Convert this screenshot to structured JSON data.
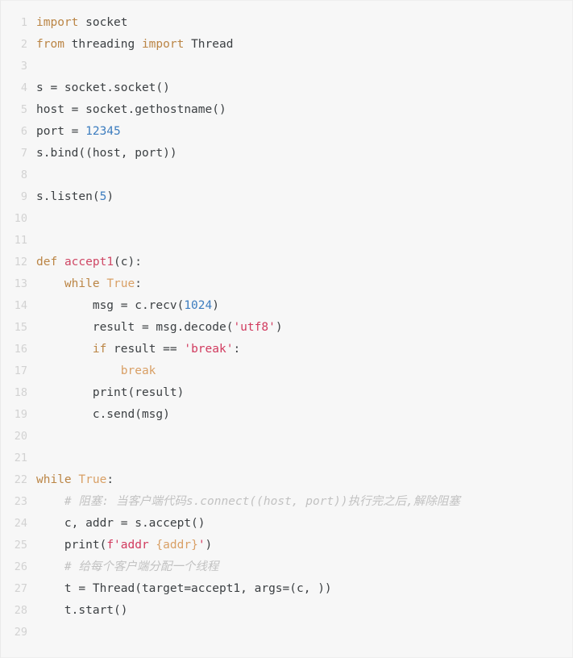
{
  "editor": {
    "language": "python",
    "background_color": "#f7f7f7",
    "border_color": "#eeeeee",
    "gutter_color": "#d2d2d2",
    "plain_text_color": "#3c4043",
    "keyword_color": "#bb8545",
    "builtin_color": "#d9a066",
    "number_color": "#3d7dbf",
    "string_color": "#d13a5e",
    "function_color": "#cf4765",
    "comment_color": "#c2c2c2",
    "total_lines": 29
  },
  "lines": [
    {
      "number": "1",
      "text": "import socket",
      "tokens": [
        {
          "t": "import",
          "c": "t-kw"
        },
        {
          "t": " socket",
          "c": "t-pl"
        }
      ]
    },
    {
      "number": "2",
      "text": "from threading import Thread",
      "tokens": [
        {
          "t": "from",
          "c": "t-kw"
        },
        {
          "t": " threading ",
          "c": "t-pl"
        },
        {
          "t": "import",
          "c": "t-kw"
        },
        {
          "t": " Thread",
          "c": "t-pl"
        }
      ]
    },
    {
      "number": "3",
      "text": "",
      "tokens": []
    },
    {
      "number": "4",
      "text": "s = socket.socket()",
      "tokens": [
        {
          "t": "s = socket.socket()",
          "c": "t-pl"
        }
      ]
    },
    {
      "number": "5",
      "text": "host = socket.gethostname()",
      "tokens": [
        {
          "t": "host = socket.gethostname()",
          "c": "t-pl"
        }
      ]
    },
    {
      "number": "6",
      "text": "port = 12345",
      "tokens": [
        {
          "t": "port = ",
          "c": "t-pl"
        },
        {
          "t": "12345",
          "c": "t-num"
        }
      ]
    },
    {
      "number": "7",
      "text": "s.bind((host, port))",
      "tokens": [
        {
          "t": "s.bind((host, port))",
          "c": "t-pl"
        }
      ]
    },
    {
      "number": "8",
      "text": "",
      "tokens": []
    },
    {
      "number": "9",
      "text": "s.listen(5)",
      "tokens": [
        {
          "t": "s.listen(",
          "c": "t-pl"
        },
        {
          "t": "5",
          "c": "t-num"
        },
        {
          "t": ")",
          "c": "t-pl"
        }
      ]
    },
    {
      "number": "10",
      "text": "",
      "tokens": []
    },
    {
      "number": "11",
      "text": "",
      "tokens": []
    },
    {
      "number": "12",
      "text": "def accept1(c):",
      "tokens": [
        {
          "t": "def",
          "c": "t-kw"
        },
        {
          "t": " ",
          "c": "t-pl"
        },
        {
          "t": "accept1",
          "c": "t-fn"
        },
        {
          "t": "(c):",
          "c": "t-pl"
        }
      ]
    },
    {
      "number": "13",
      "text": "    while True:",
      "tokens": [
        {
          "t": "    ",
          "c": "t-pl"
        },
        {
          "t": "while",
          "c": "t-kw"
        },
        {
          "t": " ",
          "c": "t-pl"
        },
        {
          "t": "True",
          "c": "t-bi"
        },
        {
          "t": ":",
          "c": "t-pl"
        }
      ]
    },
    {
      "number": "14",
      "text": "        msg = c.recv(1024)",
      "tokens": [
        {
          "t": "        msg = c.recv(",
          "c": "t-pl"
        },
        {
          "t": "1024",
          "c": "t-num"
        },
        {
          "t": ")",
          "c": "t-pl"
        }
      ]
    },
    {
      "number": "15",
      "text": "        result = msg.decode('utf8')",
      "tokens": [
        {
          "t": "        result = msg.decode(",
          "c": "t-pl"
        },
        {
          "t": "'utf8'",
          "c": "t-str"
        },
        {
          "t": ")",
          "c": "t-pl"
        }
      ]
    },
    {
      "number": "16",
      "text": "        if result == 'break':",
      "tokens": [
        {
          "t": "        ",
          "c": "t-pl"
        },
        {
          "t": "if",
          "c": "t-kw"
        },
        {
          "t": " result == ",
          "c": "t-pl"
        },
        {
          "t": "'break'",
          "c": "t-str"
        },
        {
          "t": ":",
          "c": "t-pl"
        }
      ]
    },
    {
      "number": "17",
      "text": "            break",
      "tokens": [
        {
          "t": "            ",
          "c": "t-pl"
        },
        {
          "t": "break",
          "c": "t-bi"
        }
      ]
    },
    {
      "number": "18",
      "text": "        print(result)",
      "tokens": [
        {
          "t": "        print(result)",
          "c": "t-pl"
        }
      ]
    },
    {
      "number": "19",
      "text": "        c.send(msg)",
      "tokens": [
        {
          "t": "        c.send(msg)",
          "c": "t-pl"
        }
      ]
    },
    {
      "number": "20",
      "text": "",
      "tokens": []
    },
    {
      "number": "21",
      "text": "",
      "tokens": []
    },
    {
      "number": "22",
      "text": "while True:",
      "tokens": [
        {
          "t": "while",
          "c": "t-kw"
        },
        {
          "t": " ",
          "c": "t-pl"
        },
        {
          "t": "True",
          "c": "t-bi"
        },
        {
          "t": ":",
          "c": "t-pl"
        }
      ]
    },
    {
      "number": "23",
      "text": "    # 阻塞: 当客户端代码s.connect((host, port))执行完之后,解除阻塞",
      "tokens": [
        {
          "t": "    ",
          "c": "t-pl"
        },
        {
          "t": "# 阻塞: 当客户端代码s.connect((host, port))执行完之后,解除阻塞",
          "c": "t-cm"
        }
      ]
    },
    {
      "number": "24",
      "text": "    c, addr = s.accept()",
      "tokens": [
        {
          "t": "    c, addr = s.accept()",
          "c": "t-pl"
        }
      ]
    },
    {
      "number": "25",
      "text": "    print(f'addr {addr}')",
      "tokens": [
        {
          "t": "    print(",
          "c": "t-pl"
        },
        {
          "t": "f'addr ",
          "c": "t-fstr"
        },
        {
          "t": "{addr}",
          "c": "t-fexp"
        },
        {
          "t": "'",
          "c": "t-fstr"
        },
        {
          "t": ")",
          "c": "t-pl"
        }
      ]
    },
    {
      "number": "26",
      "text": "    # 给每个客户端分配一个线程",
      "tokens": [
        {
          "t": "    ",
          "c": "t-pl"
        },
        {
          "t": "# 给每个客户端分配一个线程",
          "c": "t-cm"
        }
      ]
    },
    {
      "number": "27",
      "text": "    t = Thread(target=accept1, args=(c, ))",
      "tokens": [
        {
          "t": "    t = Thread(target=accept1, args=(c, ))",
          "c": "t-pl"
        }
      ]
    },
    {
      "number": "28",
      "text": "    t.start()",
      "tokens": [
        {
          "t": "    t.start()",
          "c": "t-pl"
        }
      ]
    },
    {
      "number": "29",
      "text": "",
      "tokens": []
    }
  ]
}
